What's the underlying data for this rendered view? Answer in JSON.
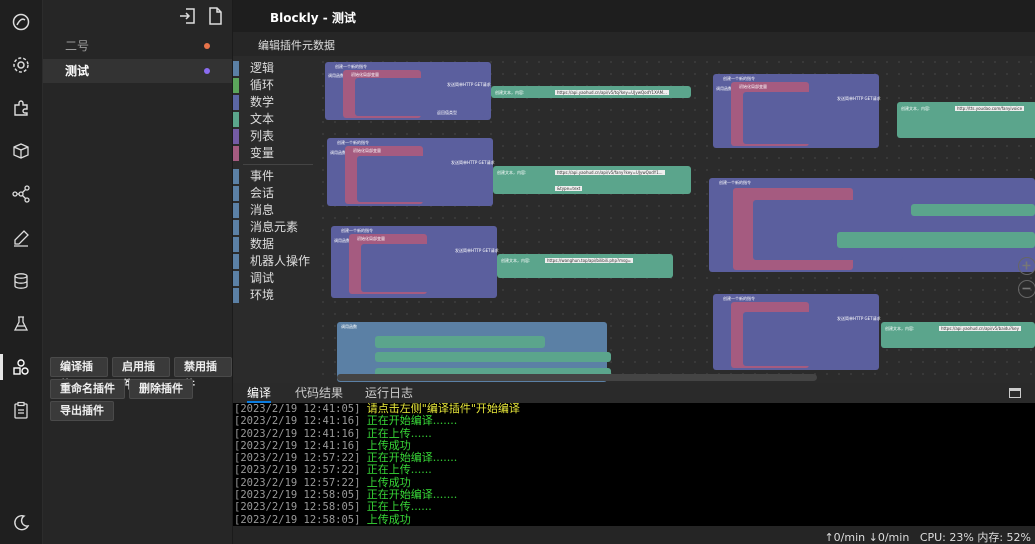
{
  "app": {
    "title": "Blockly - 测试",
    "subtitle": "编辑插件元数据"
  },
  "rail": {
    "icons": [
      "palette-icon",
      "settings-icon",
      "puzzle-icon",
      "package-icon",
      "share-icon",
      "edit-icon",
      "database-icon",
      "flask-icon",
      "blocks-icon",
      "clipboard-icon",
      "moon-icon"
    ]
  },
  "plugins": [
    {
      "name": "二号",
      "color": "#e8734a"
    },
    {
      "name": "测试",
      "color": "#8a6cf0"
    }
  ],
  "plugin_buttons": {
    "compile": "编译插件",
    "enable": "启用插件",
    "disable": "禁用插件",
    "rename": "重命名插件",
    "delete": "删除插件",
    "export": "导出插件"
  },
  "categories": [
    {
      "label": "逻辑",
      "color": "#5b80a5"
    },
    {
      "label": "循环",
      "color": "#5ba55b"
    },
    {
      "label": "数学",
      "color": "#5b67a5"
    },
    {
      "label": "文本",
      "color": "#5ba58c"
    },
    {
      "label": "列表",
      "color": "#745ba5"
    },
    {
      "label": "变量",
      "color": "#a55b80"
    },
    {
      "label": "事件",
      "color": "#5b80a5"
    },
    {
      "label": "会话",
      "color": "#5b80a5"
    },
    {
      "label": "消息",
      "color": "#5b80a5"
    },
    {
      "label": "消息元素",
      "color": "#5b80a5"
    },
    {
      "label": "数据",
      "color": "#5b80a5"
    },
    {
      "label": "机器人操作",
      "color": "#5b80a5"
    },
    {
      "label": "调试",
      "color": "#5b80a5"
    },
    {
      "label": "环境",
      "color": "#5b80a5"
    }
  ],
  "blocks": {
    "create_cmd": "创建一个新的指令",
    "call_func": "调用函数",
    "init_var": "初始化局部变量",
    "http_get": "发送简单HTTP GET请求",
    "create_text": "创建文本，内容:",
    "return_type": "返回值类型",
    "url1": "https://api.yaohud.cn/api/v5/tq?key=UJywQodY1XAM...",
    "url2": "https://api.yaohud.cn/api/v5/fany?key=UJywQodY1...",
    "url3": "https://wanghun.top/api/bilibili.php?msg=",
    "url4": "http://tts.youdao.com/fanyivoice",
    "url5": "https://api.yaohud.cn/api/v5/baidu?key",
    "param": "&type=text"
  },
  "console": {
    "tabs": [
      "编译",
      "代码结果",
      "运行日志"
    ],
    "lines": [
      {
        "ts": "[2023/2/19 12:41:05]",
        "msg": "请点击左侧\"编译插件\"开始编译",
        "yellow": true
      },
      {
        "ts": "[2023/2/19 12:41:16]",
        "msg": "正在开始编译.......",
        "yellow": false
      },
      {
        "ts": "[2023/2/19 12:41:16]",
        "msg": "正在上传......",
        "yellow": false
      },
      {
        "ts": "[2023/2/19 12:41:16]",
        "msg": "上传成功",
        "yellow": false
      },
      {
        "ts": "[2023/2/19 12:57:22]",
        "msg": "正在开始编译.......",
        "yellow": false
      },
      {
        "ts": "[2023/2/19 12:57:22]",
        "msg": "正在上传......",
        "yellow": false
      },
      {
        "ts": "[2023/2/19 12:57:22]",
        "msg": "上传成功",
        "yellow": false
      },
      {
        "ts": "[2023/2/19 12:58:05]",
        "msg": "正在开始编译.......",
        "yellow": false
      },
      {
        "ts": "[2023/2/19 12:58:05]",
        "msg": "正在上传......",
        "yellow": false
      },
      {
        "ts": "[2023/2/19 12:58:05]",
        "msg": "上传成功",
        "yellow": false
      }
    ]
  },
  "status": {
    "up": "↑0/min",
    "down": "↓0/min",
    "cpu": "CPU: 23%",
    "mem": "内存: 52%"
  }
}
